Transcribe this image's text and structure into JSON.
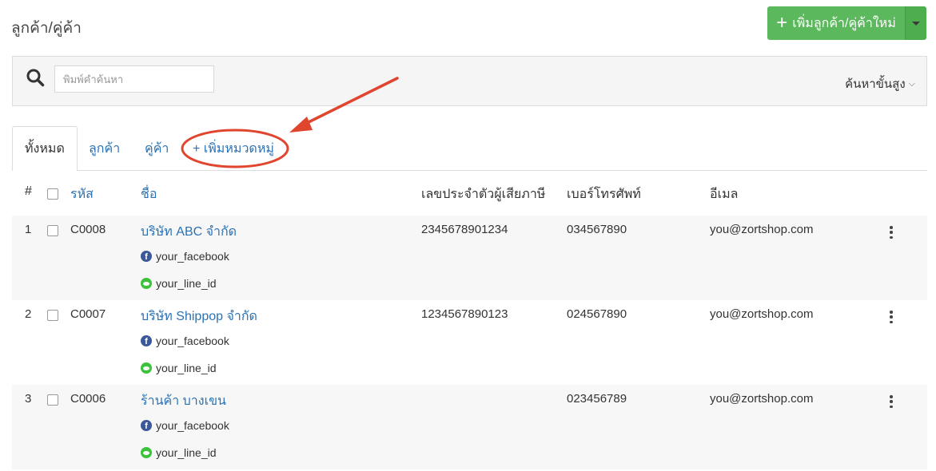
{
  "header": {
    "title": "ลูกค้า/คู่ค้า",
    "add_button_label": "เพิ่มลูกค้า/คู่ค้าใหม่",
    "add_button_icon": "plus-icon",
    "accent_color": "#5cb85c"
  },
  "search": {
    "placeholder": "พิมพ์คำค้นหา",
    "value": "",
    "advanced_label": "ค้นหาขั้นสูง"
  },
  "tabs": [
    {
      "label": "ทั้งหมด",
      "active": true
    },
    {
      "label": "ลูกค้า",
      "active": false
    },
    {
      "label": "คู่ค้า",
      "active": false
    },
    {
      "label": "+ เพิ่มหมวดหมู่",
      "active": false
    }
  ],
  "table": {
    "columns": {
      "index": "#",
      "code": "รหัส",
      "name": "ชื่อ",
      "tax_id": "เลขประจำตัวผู้เสียภาษี",
      "phone": "เบอร์โทรศัพท์",
      "email": "อีเมล"
    },
    "rows": [
      {
        "index": "1",
        "code": "C0008",
        "name": "บริษัท ABC จำกัด",
        "facebook": "your_facebook",
        "line": "your_line_id",
        "tax_id": "2345678901234",
        "phone": "034567890",
        "email": "you@zortshop.com"
      },
      {
        "index": "2",
        "code": "C0007",
        "name": "บริษัท Shippop จำกัด",
        "facebook": "your_facebook",
        "line": "your_line_id",
        "tax_id": "1234567890123",
        "phone": "024567890",
        "email": "you@zortshop.com"
      },
      {
        "index": "3",
        "code": "C0006",
        "name": "ร้านค้า บางเขน",
        "facebook": "your_facebook",
        "line": "your_line_id",
        "tax_id": "",
        "phone": "023456789",
        "email": "you@zortshop.com"
      }
    ]
  },
  "annotation": {
    "color": "#e0452e"
  }
}
